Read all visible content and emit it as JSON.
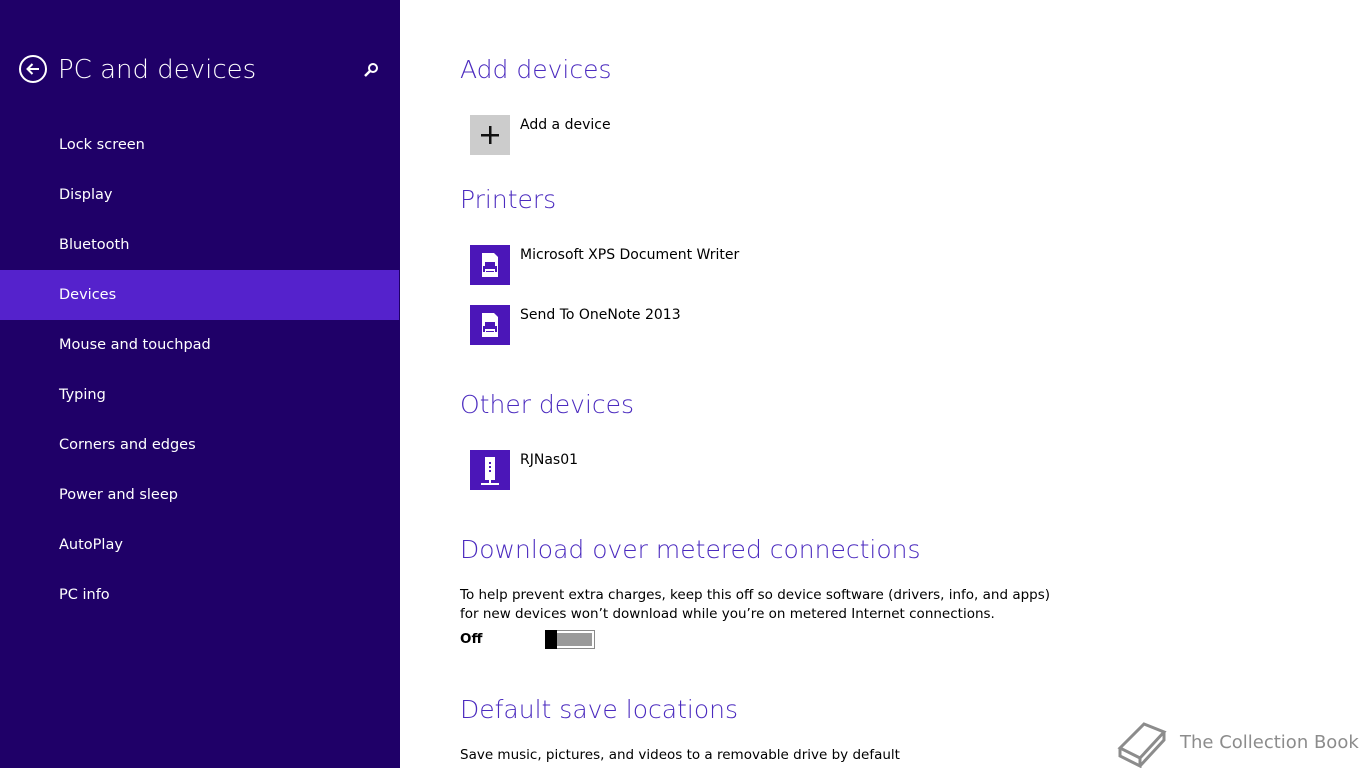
{
  "sidebar": {
    "title": "PC and devices",
    "back_icon": "back-arrow-icon",
    "search_icon": "search-icon",
    "items": [
      {
        "label": "Lock screen",
        "active": false
      },
      {
        "label": "Display",
        "active": false
      },
      {
        "label": "Bluetooth",
        "active": false
      },
      {
        "label": "Devices",
        "active": true
      },
      {
        "label": "Mouse and touchpad",
        "active": false
      },
      {
        "label": "Typing",
        "active": false
      },
      {
        "label": "Corners and edges",
        "active": false
      },
      {
        "label": "Power and sleep",
        "active": false
      },
      {
        "label": "AutoPlay",
        "active": false
      },
      {
        "label": "PC info",
        "active": false
      }
    ],
    "colors": {
      "background": "#1f0068",
      "active": "#5522cc"
    }
  },
  "main": {
    "add_devices": {
      "title": "Add devices",
      "button_label": "Add a device",
      "icon": "plus-icon"
    },
    "printers": {
      "title": "Printers",
      "items": [
        {
          "label": "Microsoft XPS Document Writer",
          "icon": "printer-icon"
        },
        {
          "label": "Send To OneNote 2013",
          "icon": "printer-icon"
        }
      ]
    },
    "other_devices": {
      "title": "Other devices",
      "items": [
        {
          "label": "RJNas01",
          "icon": "network-storage-icon"
        }
      ]
    },
    "metered": {
      "title": "Download over metered connections",
      "description": "To help prevent extra charges, keep this off so device software (drivers, info, and apps) for new devices won’t download while you’re on metered Internet connections.",
      "toggle_label": "Off",
      "toggle_on": false
    },
    "save_locations": {
      "title": "Default save locations",
      "description": "Save music, pictures, and videos to a removable drive by default"
    },
    "accent_color": "#4b2bbf"
  },
  "watermark": {
    "text": "The Collection Book",
    "icon": "book-icon"
  }
}
